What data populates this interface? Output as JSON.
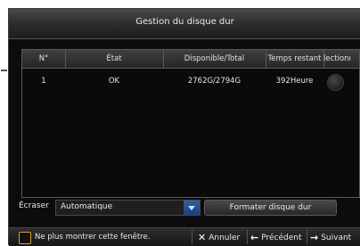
{
  "dialog": {
    "title": "Gestion du disque dur"
  },
  "table": {
    "headers": [
      "N°",
      "État",
      "Disponible/Total",
      "Temps restant",
      "lectionı"
    ],
    "rows": [
      {
        "num": "1",
        "state": "OK",
        "capacity": "2762G/2794G",
        "remaining": "392Heure"
      }
    ]
  },
  "overwrite": {
    "label": "Écraser",
    "selected": "Automatique"
  },
  "format_button": "Formater disque dur",
  "footer": {
    "checkbox_label": "Ne plus montrer cette fenêtre.",
    "cancel_label": "Annuler",
    "prev_label": "Précédent",
    "next_label": "Suivant"
  },
  "colors": {
    "checkbox_border": "#e0a020",
    "dropdown_arrow": "#2f5fa8"
  },
  "icons": {
    "cancel": "close-x-icon",
    "prev": "arrow-left-icon",
    "next": "arrow-right-icon",
    "dropdown": "chevron-down-icon"
  }
}
